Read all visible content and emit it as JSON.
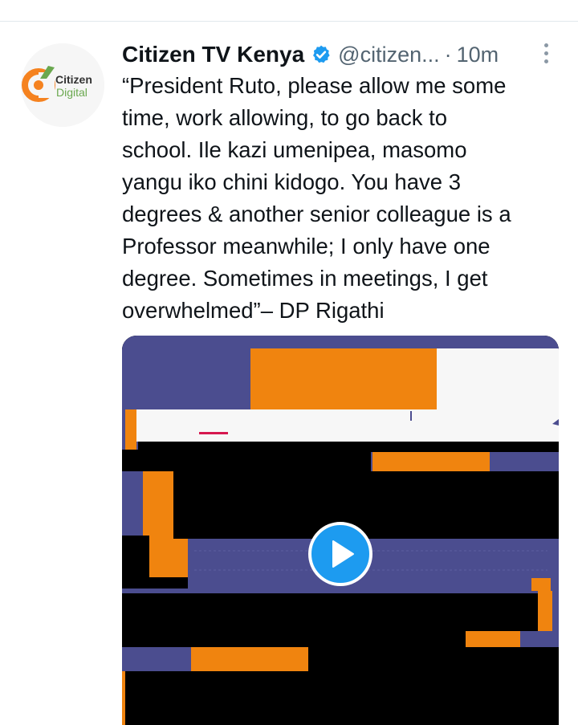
{
  "tweet": {
    "author_name": "Citizen TV Kenya",
    "author_handle": "@citizen...",
    "separator": "·",
    "timestamp": "10m",
    "verified": true,
    "text": "“President Ruto, please allow me some\ntime, work allowing, to go back to\nschool. Ile kazi umenipea, masomo\nyangu iko chini kidogo. You have 3\ndegrees & another senior colleague is a\nProfessor meanwhile; I only have one\ndegree. Sometimes in meetings, I get\noverwhelmed”– DP Rigathi"
  },
  "avatar": {
    "logo_line1": "Citizen",
    "logo_line2": "Digital",
    "brand_orange": "#f5821f",
    "brand_green": "#6aa84f"
  },
  "media": {
    "type": "video",
    "play_icon": "play-icon",
    "colors": {
      "blue": "#4b4d8f",
      "orange": "#f0840f",
      "black": "#000000",
      "white": "#f7f7f7"
    }
  },
  "colors": {
    "verified": "#1d9bf0",
    "secondary_text": "#536471"
  }
}
